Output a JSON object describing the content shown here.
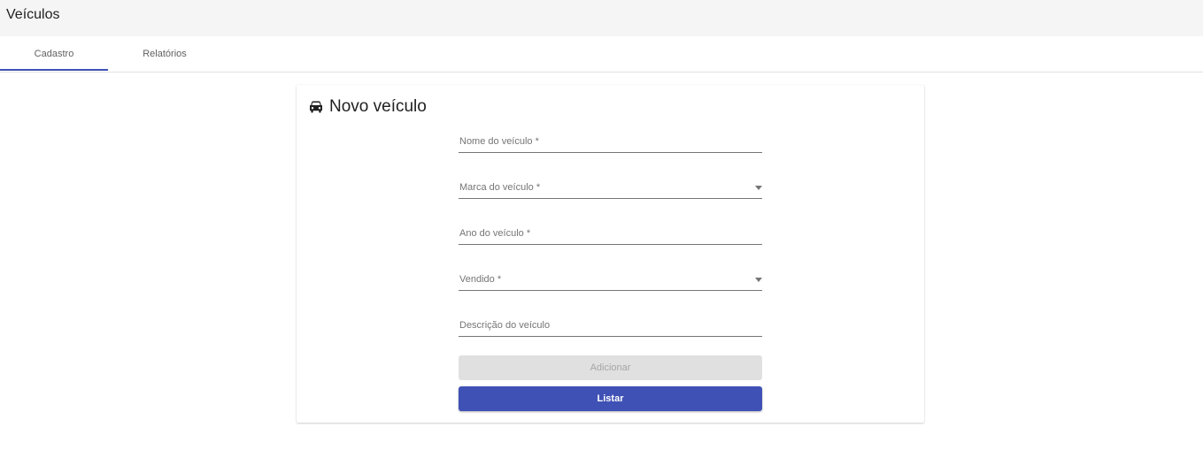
{
  "header": {
    "title": "Veículos"
  },
  "tabs": [
    {
      "label": "Cadastro",
      "active": true
    },
    {
      "label": "Relatórios",
      "active": false
    }
  ],
  "card": {
    "icon": "car-icon",
    "title": "Novo veículo",
    "fields": {
      "nome": {
        "label": "Nome do veículo *",
        "value": ""
      },
      "marca": {
        "label": "Marca do veículo *",
        "value": ""
      },
      "ano": {
        "label": "Ano do veículo *",
        "value": ""
      },
      "vendido": {
        "label": "Vendido *",
        "value": ""
      },
      "descricao": {
        "label": "Descrição do veículo",
        "value": ""
      }
    },
    "buttons": {
      "add_label": "Adicionar",
      "add_disabled": true,
      "list_label": "Listar"
    }
  },
  "colors": {
    "accent": "#3f51b5",
    "header_bg": "#f5f5f5",
    "disabled_bg": "#e0e0e0"
  }
}
